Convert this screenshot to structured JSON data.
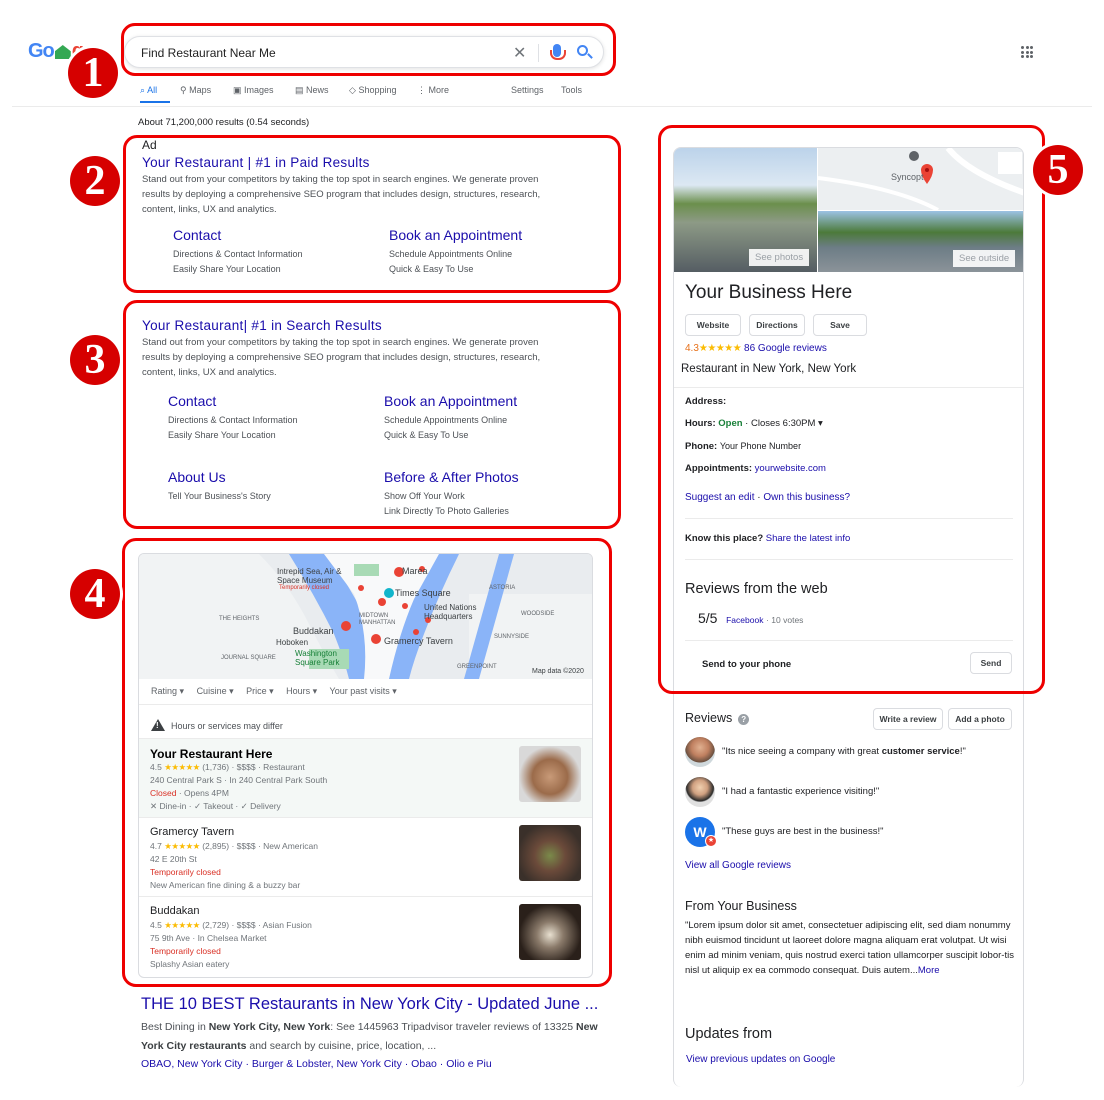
{
  "logo": {
    "text_a": "Go",
    "text_b": "g"
  },
  "search": {
    "query": "Find Restaurant Near Me"
  },
  "tabs": [
    {
      "label": "All",
      "icon": "search-icon"
    },
    {
      "label": "Maps",
      "icon": "pin-icon"
    },
    {
      "label": "Images",
      "icon": "image-icon"
    },
    {
      "label": "News",
      "icon": "news-icon"
    },
    {
      "label": "Shopping",
      "icon": "tag-icon"
    },
    {
      "label": "More",
      "icon": "dots-icon"
    },
    {
      "label": "Settings"
    },
    {
      "label": "Tools"
    }
  ],
  "stats": "About 71,200,000 results (0.54 seconds)",
  "badges": [
    "1",
    "2",
    "3",
    "4",
    "5"
  ],
  "ad_result": {
    "ad_label": "Ad",
    "title": "Your Restaurant | #1 in Paid Results",
    "desc1": "Stand out from your competitors by taking the top spot in search engines. We generate proven",
    "desc2": "results by deploying a comprehensive SEO program that includes design, structures, research,",
    "desc3": "content, links, UX and analytics.",
    "sitelinks": [
      {
        "title": "Contact",
        "d1": "Directions & Contact Information",
        "d2": "Easily Share Your Location"
      },
      {
        "title": "Book an Appointment",
        "d1": "Schedule Appointments Online",
        "d2": "Quick & Easy To Use"
      }
    ]
  },
  "organic_top": {
    "title": "Your Restaurant| #1 in Search Results",
    "desc1": "Stand out from your competitors by taking the top spot in search engines. We generate proven",
    "desc2": "results by deploying a comprehensive SEO program that includes design, structures, research,",
    "desc3": "content, links, UX and analytics.",
    "sitelinks": [
      {
        "title": "Contact",
        "d1": "Directions & Contact Information",
        "d2": "Easily Share Your Location"
      },
      {
        "title": "Book an Appointment",
        "d1": "Schedule Appointments Online",
        "d2": "Quick & Easy To Use"
      },
      {
        "title": "About Us",
        "d1": "Tell Your Business's Story",
        "d2": ""
      },
      {
        "title": "Before & After Photos",
        "d1": "Show Off Your Work",
        "d2": "Link Directly To Photo Galleries"
      }
    ]
  },
  "map_pack": {
    "map_labels": [
      "Marea",
      "Times Square",
      "United Nations Headquarters",
      "Buddakan",
      "Gramercy Tavern",
      "Washington Square Park",
      "Hoboken",
      "MIDTOWN MANHATTAN",
      "ASTORIA",
      "SUNNYSIDE",
      "WOODSIDE",
      "GREENPOINT",
      "THE HEIGHTS",
      "JOURNAL SQUARE",
      "Intrepid Sea, Air & Space Museum",
      "Temporarily closed",
      "Map data ©2020"
    ],
    "filters": [
      "Rating ▾",
      "Cuisine ▾",
      "Price ▾",
      "Hours ▾",
      "Your past visits ▾"
    ],
    "warning": "Hours or services may differ",
    "listings": [
      {
        "name": "Your Restaurant Here",
        "rating": "4.5",
        "stars": "★★★★★",
        "meta": "(1,736) · $$$$ · Restaurant",
        "address": "240 Central Park S · In 240 Central Park South",
        "status": "Closed",
        "status_extra": " · Opens 4PM",
        "sub": "✕ Dine-in · ✓ Takeout · ✓ Delivery"
      },
      {
        "name": "Gramercy Tavern",
        "rating": "4.7",
        "stars": "★★★★★",
        "meta": "(2,895) · $$$$ · New American",
        "address": "42 E 20th St",
        "status": "Temporarily closed",
        "status_extra": "",
        "sub": "New American fine dining & a buzzy bar"
      },
      {
        "name": "Buddakan",
        "rating": "4.5",
        "stars": "★★★★★",
        "meta": "(2,729) · $$$$ · Asian Fusion",
        "address": "75 9th Ave · In Chelsea Market",
        "status": "Temporarily closed",
        "status_extra": "",
        "sub": "Splashy Asian eatery"
      }
    ]
  },
  "organic_result": {
    "title": "THE 10 BEST Restaurants in New York City - Updated June ...",
    "desc_a": "Best Dining in ",
    "desc_b": "New York City, New York",
    "desc_c": ": See 1445963 Tripadvisor traveler reviews of 13325 ",
    "desc_d": "New York City restaurants",
    "desc_e": " and search by cuisine, price, location, ...",
    "links": "OBAO, New York City · Burger & Lobster, New York City · Obao · Olio e Piu"
  },
  "knowledge_panel": {
    "map_label": "Syncopt",
    "see_photos": "See photos",
    "see_outside": "See outside",
    "title": "Your Business Here",
    "buttons": [
      "Website",
      "Directions",
      "Save"
    ],
    "rating": "4.3",
    "stars": "★★★★★",
    "reviews_link": "86 Google reviews",
    "category": "Restaurant in New York, New York",
    "address_label": "Address:",
    "hours_label": "Hours:",
    "hours_open": "Open",
    "hours_close": " · Closes 6:30PM ▾",
    "phone_label": "Phone:",
    "phone_value": "Your Phone Number",
    "appt_label": "Appointments:",
    "appt_value": "yourwebsite.com",
    "suggest_edit": "Suggest an edit",
    "own_business": "Own this business?",
    "know_label": "Know this place?",
    "share_info": "Share the latest info",
    "reviews_web_title": "Reviews from the web",
    "web_score": "5/5",
    "web_source": "Facebook",
    "web_votes": "· 10 votes",
    "send_label": "Send to your phone",
    "send_button": "Send",
    "reviews_title": "Reviews",
    "write_review": "Write a review",
    "add_photo": "Add a photo",
    "reviews": [
      {
        "pre": "\"Its nice seeing a company with great ",
        "bold": "customer service",
        "post": "!\""
      },
      {
        "pre": "\"I had a fantastic experience visiting!\"",
        "bold": "",
        "post": ""
      },
      {
        "pre": "\"These guys are best in the business!\"",
        "bold": "",
        "post": ""
      }
    ],
    "avatar_initial": "W",
    "view_all": "View all Google reviews",
    "from_title": "From Your Business",
    "from_text": "\"Lorem ipsum dolor sit amet, consectetuer adipiscing elit, sed diam nonummy nibh euismod tincidunt ut laoreet dolore magna aliquam erat volutpat. Ut wisi enim ad minim veniam, quis nostrud exerci tation ullamcorper suscipit lobor-tis nisl ut aliquip ex ea commodo consequat. Duis autem...",
    "more": "More",
    "updates_title": "Updates from",
    "updates_link": "View previous updates on Google"
  }
}
